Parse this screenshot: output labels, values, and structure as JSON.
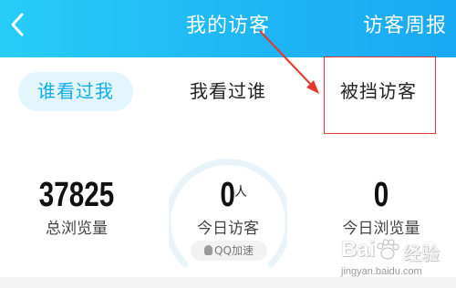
{
  "header": {
    "title": "我的访客",
    "right_action": "访客周报",
    "back_icon": "chevron-left-icon",
    "colors": {
      "gradient_start": "#27cdf7",
      "gradient_end": "#1aa9f3",
      "text": "#ffffff"
    }
  },
  "tabs": [
    {
      "label": "谁看过我",
      "active": true
    },
    {
      "label": "我看过谁",
      "active": false
    },
    {
      "label": "被挡访客",
      "active": false
    }
  ],
  "stats": {
    "total_views": {
      "value": "37825",
      "label": "总浏览量"
    },
    "today_visitors": {
      "value": "0",
      "unit": "人",
      "label": "今日访客"
    },
    "today_views": {
      "value": "0",
      "label": "今日浏览量"
    }
  },
  "badge": {
    "label": "QQ加速",
    "icon": "penguin-icon"
  },
  "annotation": {
    "color": "#e5372d"
  },
  "watermark": {
    "logo": "Bai",
    "suffix": "经验",
    "url": "jingyan.baidu.com"
  },
  "accent_color": "#10aef0"
}
